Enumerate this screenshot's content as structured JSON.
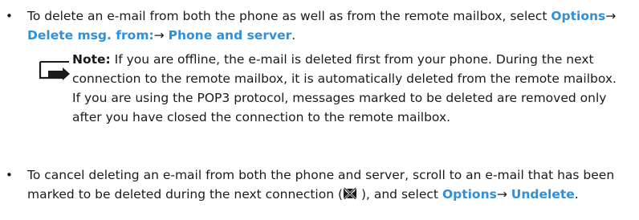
{
  "bullet_symbol": "•",
  "item1": {
    "text_before": "To delete an e-mail from both the phone as well as from the remote mailbox, select ",
    "menu_options": "Options",
    "arrow1": "→",
    "menu_delete_from": "Delete msg. from:",
    "arrow2": "→",
    "menu_phone_server": "Phone and server",
    "text_after": "."
  },
  "note": {
    "label": "Note:",
    "text": " If you are offline, the e-mail is deleted first from your phone. During the next connection to the remote mailbox, it is automatically deleted from the remote mailbox. If you are using the POP3 protocol, messages marked to be deleted are removed only after you have closed the connection to the remote mailbox."
  },
  "item2": {
    "text_before": "To cancel deleting an e-mail from both the phone and server, scroll to an e-mail that has been marked to be deleted during the next connection (",
    "icon_name": "marked-for-deletion-icon",
    "text_middle": " ), and select ",
    "menu_options": "Options",
    "arrow": "→",
    "menu_undelete": "Undelete",
    "text_after": "."
  },
  "colors": {
    "link": "#2f8fd8",
    "text": "#1a1a1a"
  }
}
